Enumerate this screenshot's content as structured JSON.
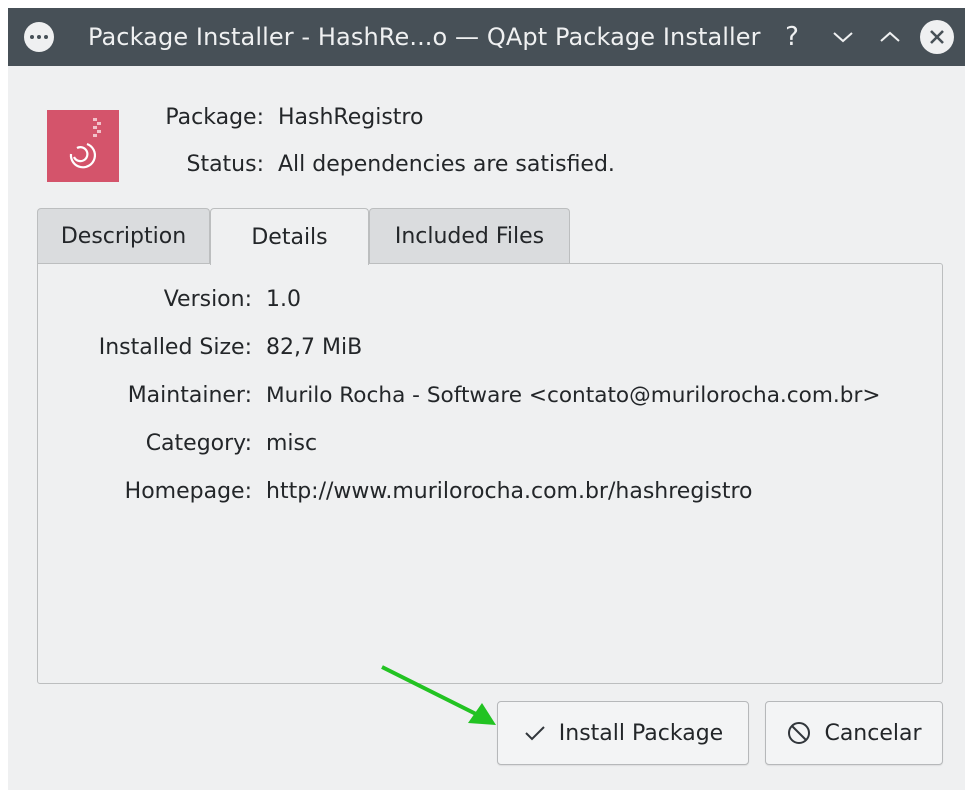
{
  "window": {
    "title": "Package Installer - HashRe...o — QApt Package Installer",
    "help_glyph": "?",
    "buttons": [
      "menu-icon",
      "help-icon",
      "minimize-icon",
      "maximize-icon",
      "close-icon"
    ]
  },
  "header": {
    "package_label": "Package:",
    "package_value": "HashRegistro",
    "status_label": "Status:",
    "status_value": "All dependencies are satisfied.",
    "icon": "debian-package-icon",
    "icon_color": "#d4546b"
  },
  "tabs": [
    {
      "label": "Description",
      "active": false
    },
    {
      "label": "Details",
      "active": true
    },
    {
      "label": "Included Files",
      "active": false
    }
  ],
  "details": [
    {
      "label": "Version:",
      "value": "1.0"
    },
    {
      "label": "Installed Size:",
      "value": "82,7 MiB"
    },
    {
      "label": "Maintainer:",
      "value": "Murilo Rocha - Software <contato@murilorocha.com.br>"
    },
    {
      "label": "Category:",
      "value": "misc"
    },
    {
      "label": "Homepage:",
      "value": "http://www.murilorocha.com.br/hashregistro"
    }
  ],
  "actions": {
    "install_label": "Install Package",
    "install_icon": "checkmark-icon",
    "cancel_label": "Cancelar",
    "cancel_icon": "cancel-circle-icon"
  },
  "annotation": {
    "arrow_color": "#22c322"
  }
}
